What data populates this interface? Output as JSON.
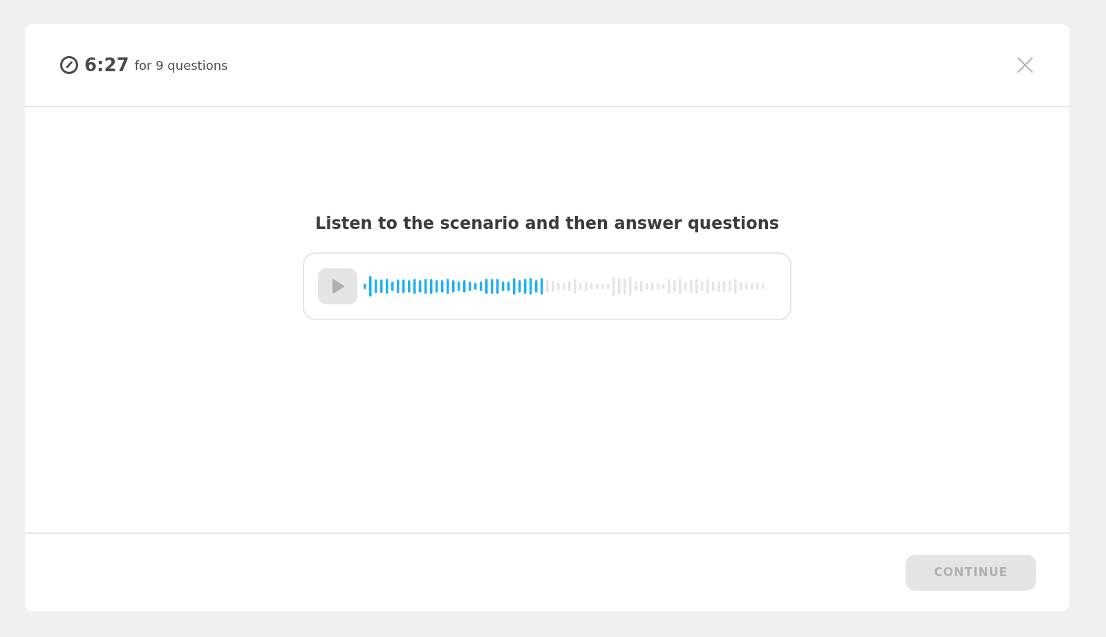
{
  "timer": {
    "time": "6:27",
    "caption": "for 9 questions"
  },
  "prompt": "Listen to the scenario and then answer questions",
  "audio": {
    "level": 0.45
  },
  "continue_button": {
    "label": "CONTINUE",
    "disabled": true
  }
}
